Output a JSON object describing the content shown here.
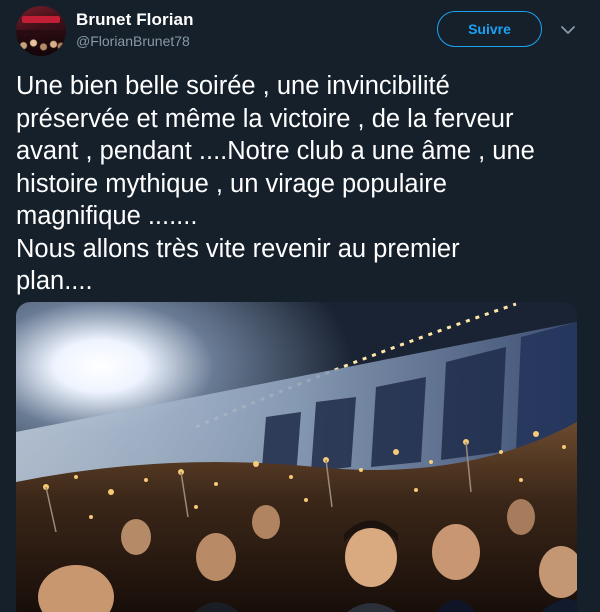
{
  "user": {
    "display_name": "Brunet Florian",
    "handle": "@FlorianBrunet78",
    "avatar_icon": "profile-photo-icon"
  },
  "actions": {
    "follow_label": "Suivre",
    "menu_icon": "chevron-down-icon"
  },
  "tweet": {
    "lines": [
      "Une bien belle soirée , une invincibilité",
      "préservée et même la victoire , de la ferveur",
      "avant , pendant ....Notre club a une âme , une",
      "histoire mythique , un virage populaire",
      "magnifique .......",
      "Nous allons très vite revenir au premier",
      "plan...."
    ]
  },
  "media": {
    "description_icon": "stadium-crowd-photo-icon"
  },
  "colors": {
    "background": "#15202b",
    "text_primary": "#ffffff",
    "text_secondary": "#8899a6",
    "accent": "#1da1f2"
  }
}
